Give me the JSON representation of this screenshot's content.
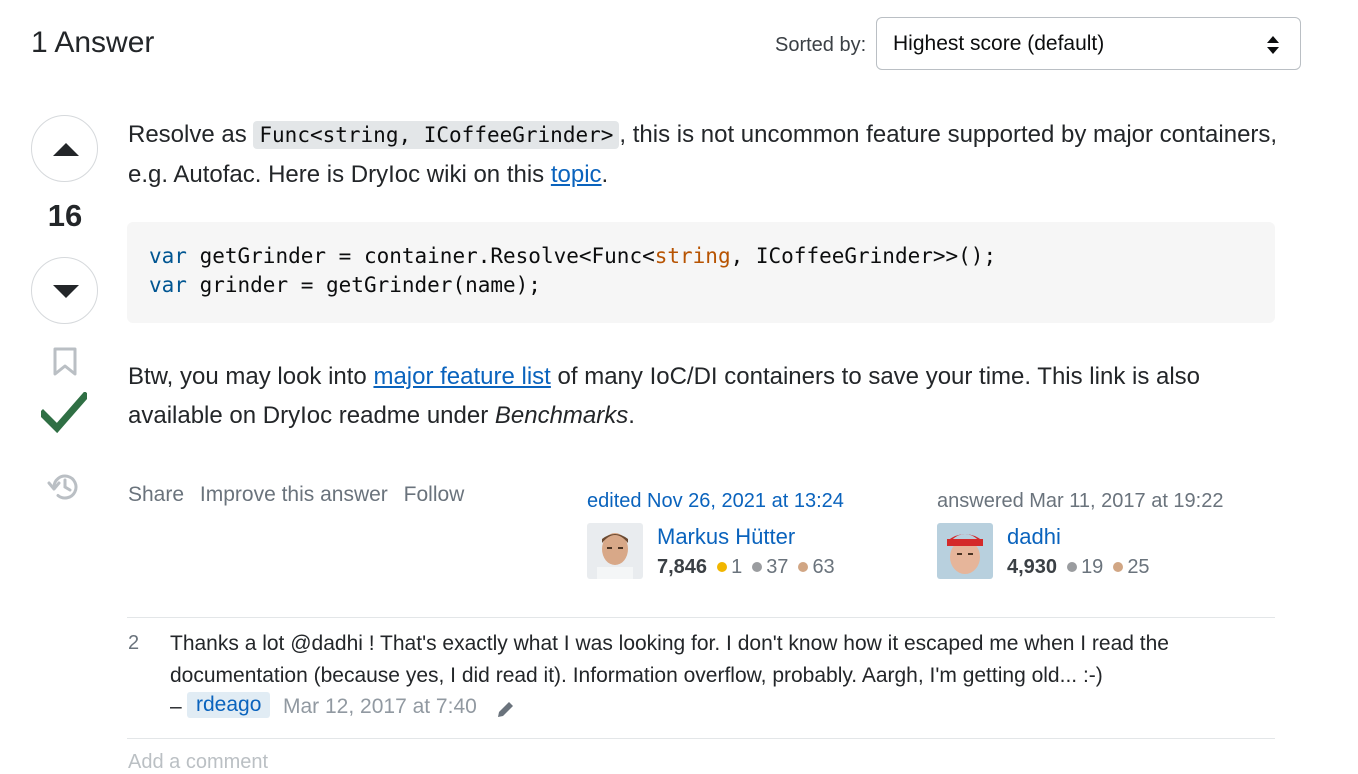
{
  "header": {
    "answers_count": "1 Answer",
    "sorted_label": "Sorted by:",
    "sort_value": "Highest score (default)"
  },
  "vote": {
    "score": "16"
  },
  "post": {
    "p1_before": "Resolve as ",
    "p1_code": "Func<string, ICoffeeGrinder>",
    "p1_mid": ", this is not uncommon feature supported by major containers, e.g. Autofac. Here is DryIoc wiki on this ",
    "p1_link": "topic",
    "p1_end": ".",
    "code_line1": {
      "kw": "var",
      "a": " getGrinder = container.Resolve<Func<",
      "ty": "string",
      "b": ", ICoffeeGrinder>>();"
    },
    "code_line2": {
      "kw": "var",
      "a": " grinder = getGrinder(name);"
    },
    "p2_before": "Btw, you may look into ",
    "p2_link": "major feature list",
    "p2_mid": " of many IoC/DI containers to save your time. This link is also available on DryIoc readme under ",
    "p2_em": "Benchmarks",
    "p2_end": "."
  },
  "menu": {
    "share": "Share",
    "improve": "Improve this answer",
    "follow": "Follow"
  },
  "editor": {
    "action": "edited Nov 26, 2021 at 13:24",
    "name": "Markus Hütter",
    "reputation": "7,846",
    "gold": "1",
    "silver": "37",
    "bronze": "63"
  },
  "author": {
    "action": "answered Mar 11, 2017 at 19:22",
    "name": "dadhi",
    "reputation": "4,930",
    "silver": "19",
    "bronze": "25"
  },
  "comment": {
    "score": "2",
    "text": "Thanks a lot @dadhi ! That's exactly what I was looking for. I don't know how it escaped me when I read the documentation (because yes, I did read it). Information overflow, probably. Aargh, I'm getting old... :-)",
    "dash": "–",
    "user": "rdeago",
    "date": "Mar 12, 2017 at 7:40"
  },
  "add_comment": "Add a comment",
  "colors": {
    "link": "#0a63bd",
    "accepted": "#2f6f44",
    "gold": "#f1b600",
    "silver": "#9a9c9f",
    "bronze": "#d1a684"
  }
}
